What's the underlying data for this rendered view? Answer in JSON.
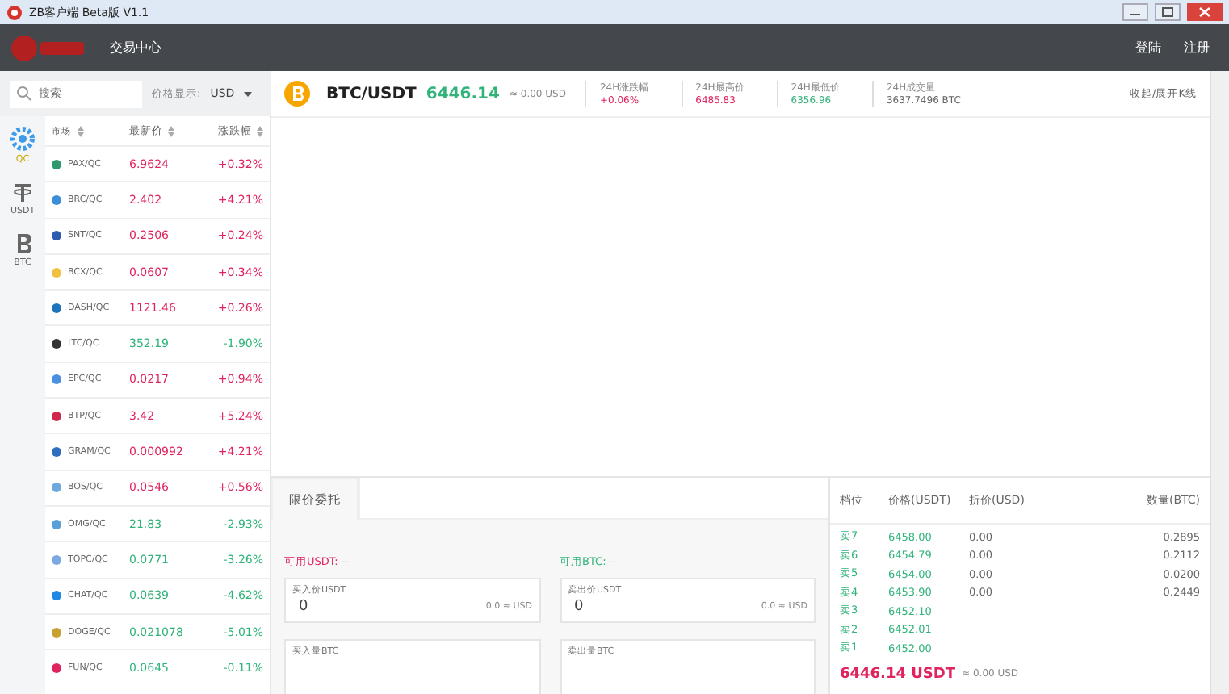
{
  "window": {
    "title": "ZB客户端 Beta版 V1.1"
  },
  "nav": {
    "items": [
      "交易中心"
    ],
    "right": [
      "登陆",
      "注册"
    ]
  },
  "search": {
    "placeholder": "搜索"
  },
  "price_display": {
    "label": "价格显示:",
    "value": "USD"
  },
  "ticker": {
    "pair": "BTC/USDT",
    "price": "6446.14",
    "approx": "≈ 0.00 USD",
    "toggle": "收起/展开K线",
    "stats": [
      {
        "label": "24H涨跌幅",
        "value": "+0.06%",
        "kind": "rise"
      },
      {
        "label": "24H最高价",
        "value": "6485.83",
        "kind": "rise"
      },
      {
        "label": "24H最低价",
        "value": "6356.96",
        "kind": "fall"
      },
      {
        "label": "24H成交量",
        "value": "3637.7496 BTC",
        "kind": "plain"
      }
    ]
  },
  "market_tabs": [
    {
      "label": "QC",
      "selected": true
    },
    {
      "label": "USDT",
      "selected": false
    },
    {
      "label": "BTC",
      "selected": false
    }
  ],
  "market_columns": [
    "市场",
    "最新价",
    "涨跌幅"
  ],
  "markets": [
    {
      "name": "PAX/QC",
      "price": "6.9624",
      "change": "+0.32%",
      "rising": true,
      "color": "#2e9a6e"
    },
    {
      "name": "BRC/QC",
      "price": "2.402",
      "change": "+4.21%",
      "rising": true,
      "color": "#3a8fd6"
    },
    {
      "name": "SNT/QC",
      "price": "0.2506",
      "change": "+0.24%",
      "rising": true,
      "color": "#2a5db0"
    },
    {
      "name": "BCX/QC",
      "price": "0.0607",
      "change": "+0.34%",
      "rising": true,
      "color": "#f0c040"
    },
    {
      "name": "DASH/QC",
      "price": "1121.46",
      "change": "+0.26%",
      "rising": true,
      "color": "#1c75bc"
    },
    {
      "name": "LTC/QC",
      "price": "352.19",
      "change": "-1.90%",
      "rising": false,
      "color": "#333333"
    },
    {
      "name": "EPC/QC",
      "price": "0.0217",
      "change": "+0.94%",
      "rising": true,
      "color": "#4a90e2"
    },
    {
      "name": "BTP/QC",
      "price": "3.42",
      "change": "+5.24%",
      "rising": true,
      "color": "#d0284a"
    },
    {
      "name": "GRAM/QC",
      "price": "0.000992",
      "change": "+4.21%",
      "rising": true,
      "color": "#2e6fc0"
    },
    {
      "name": "BOS/QC",
      "price": "0.0546",
      "change": "+0.56%",
      "rising": true,
      "color": "#6fa8dc"
    },
    {
      "name": "OMG/QC",
      "price": "21.83",
      "change": "-2.93%",
      "rising": false,
      "color": "#5aa0d8"
    },
    {
      "name": "TOPC/QC",
      "price": "0.0771",
      "change": "-3.26%",
      "rising": false,
      "color": "#7da7e0"
    },
    {
      "name": "CHAT/QC",
      "price": "0.0639",
      "change": "-4.62%",
      "rising": false,
      "color": "#1e88e5"
    },
    {
      "name": "DOGE/QC",
      "price": "0.021078",
      "change": "-5.01%",
      "rising": false,
      "color": "#c8a230"
    },
    {
      "name": "FUN/QC",
      "price": "0.0645",
      "change": "-0.11%",
      "rising": false,
      "color": "#e0245e"
    }
  ],
  "order_tabs": [
    {
      "label": "限价委托",
      "selected": true
    }
  ],
  "buy": {
    "available": "可用USDT: --",
    "price_label": "买入价USDT",
    "price_value": "0",
    "approx": "0.0 ≈ USD",
    "amount_label": "买入量BTC"
  },
  "sell": {
    "available": "可用BTC: --",
    "price_label": "卖出价USDT",
    "price_value": "0",
    "approx": "0.0 ≈ USD",
    "amount_label": "卖出量BTC"
  },
  "orderbook": {
    "columns": [
      "档位",
      "价格(USDT)",
      "折价(USD)",
      "数量(BTC)"
    ],
    "rows": [
      {
        "level": "卖7",
        "price": "6458.00",
        "discount": "0.00",
        "amount": "0.2895"
      },
      {
        "level": "卖6",
        "price": "6454.79",
        "discount": "0.00",
        "amount": "0.2112"
      },
      {
        "level": "卖5",
        "price": "6454.00",
        "discount": "0.00",
        "amount": "0.0200"
      },
      {
        "level": "卖4",
        "price": "6453.90",
        "discount": "0.00",
        "amount": "0.2449"
      },
      {
        "level": "卖3",
        "price": "6452.10"
      },
      {
        "level": "卖2",
        "price": "6452.01"
      },
      {
        "level": "卖1",
        "price": "6452.00"
      }
    ],
    "last_price": "6446.14 USDT",
    "last_approx": "≈ 0.00 USD"
  }
}
